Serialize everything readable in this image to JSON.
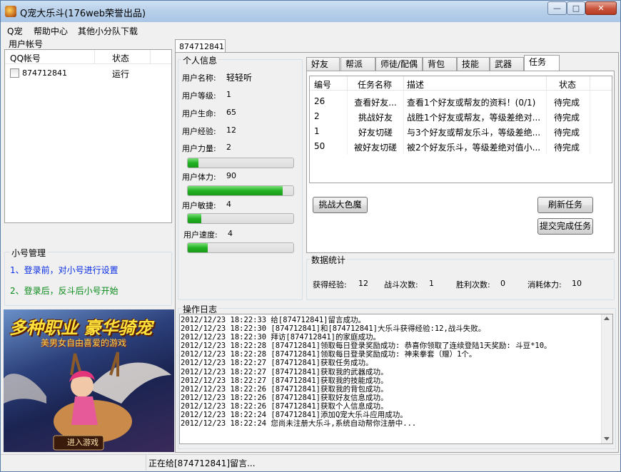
{
  "window": {
    "title": "Q宠大乐斗(176web荣誉出品)",
    "minimize": "—",
    "maximize": "□",
    "close": "✕"
  },
  "menu": [
    "Q宠",
    "帮助中心",
    "其他小分队下载"
  ],
  "accounts": {
    "label": "用户帐号",
    "col_qq": "QQ帐号",
    "col_status": "状态",
    "rows": [
      {
        "qq": "874712841",
        "status": "运行"
      }
    ]
  },
  "sub_accounts": {
    "label": "小号管理",
    "link1": "1、登录前，对小号进行设置",
    "link2": "2、登录后，反斗后小号开始"
  },
  "ad": {
    "headline": "多种职业 豪华骑宠",
    "subline": "美男女自由喜爱的游戏",
    "enter": "进入游戏"
  },
  "main_tab": "874712841",
  "profile": {
    "label": "个人信息",
    "name_label": "用户名称:",
    "name": "轻轻听",
    "level_label": "用户等级:",
    "level": "1",
    "hp_label": "用户生命:",
    "hp": "65",
    "exp_label": "用户经验:",
    "exp": "12",
    "power_label": "用户力量:",
    "power": "2",
    "stamina_label": "用户体力:",
    "stamina": "90",
    "agility_label": "用户敏捷:",
    "agility": "4",
    "speed_label": "用户速度:",
    "speed": "4",
    "bars": {
      "power": 0.1,
      "stamina": 0.9,
      "agility": 0.13,
      "speed": 0.19
    }
  },
  "tabs": [
    "好友",
    "帮派",
    "师徒/配偶",
    "背包",
    "技能",
    "武器",
    "任务"
  ],
  "active_tab": "任务",
  "tasks": {
    "columns": [
      "编号",
      "任务名称",
      "描述",
      "状态"
    ],
    "rows": [
      {
        "id": "26",
        "name": "查看好友...",
        "desc": "查看1个好友或帮友的资料！(0/1)",
        "status": "待完成"
      },
      {
        "id": "2",
        "name": "挑战好友",
        "desc": "战胜1个好友或帮友，等级差绝对...",
        "status": "待完成"
      },
      {
        "id": "1",
        "name": "好友切磋",
        "desc": "与3个好友或帮友乐斗，等级差绝...",
        "status": "待完成"
      },
      {
        "id": "50",
        "name": "被好友切磋",
        "desc": "被2个好友乐斗，等级差绝对值小...",
        "status": "待完成"
      }
    ],
    "btn_challenge": "挑战大色魔",
    "btn_refresh": "刷新任务",
    "btn_submit": "提交完成任务"
  },
  "stats": {
    "label": "数据统计",
    "exp_label": "获得经验:",
    "exp": "12",
    "battles_label": "战斗次数:",
    "battles": "1",
    "wins_label": "胜利次数:",
    "wins": "0",
    "stamina_label": "消耗体力:",
    "stamina": "10"
  },
  "log": {
    "label": "操作日志",
    "lines": [
      "2012/12/23 18:22:33 给[874712841]留言成功。",
      "2012/12/23 18:22:30 [874712841]和[874712841]大乐斗获得经验:12,战斗失败。",
      "2012/12/23 18:22:30 拜访[874712841]的家庭成功。",
      "2012/12/23 18:22:28 [874712841]领取每日登录奖励成功: 恭喜你领取了连续登陆1天奖励: 斗豆*10。",
      "2012/12/23 18:22:28 [874712841]领取每日登录奖励成功: 神来拳套（赠）1个。",
      "2012/12/23 18:22:27 [874712841]获取任务成功。",
      "2012/12/23 18:22:27 [874712841]获取我的武器成功。",
      "2012/12/23 18:22:27 [874712841]获取我的技能成功。",
      "2012/12/23 18:22:26 [874712841]获取我的背包成功。",
      "2012/12/23 18:22:26 [874712841]获取好友信息成功。",
      "2012/12/23 18:22:26 [874712841]获取个人信息成功。",
      "2012/12/23 18:22:24 [874712841]添加Q宠大乐斗应用成功。",
      "2012/12/23 18:22:24 您尚未注册大乐斗,系统自动帮你注册中..."
    ]
  },
  "statusbar": {
    "text": "正在给[874712841]留言..."
  },
  "colors": {
    "link": "#0a2ee6",
    "progress": "#22b122",
    "title_bg": "#b7cfe9"
  }
}
